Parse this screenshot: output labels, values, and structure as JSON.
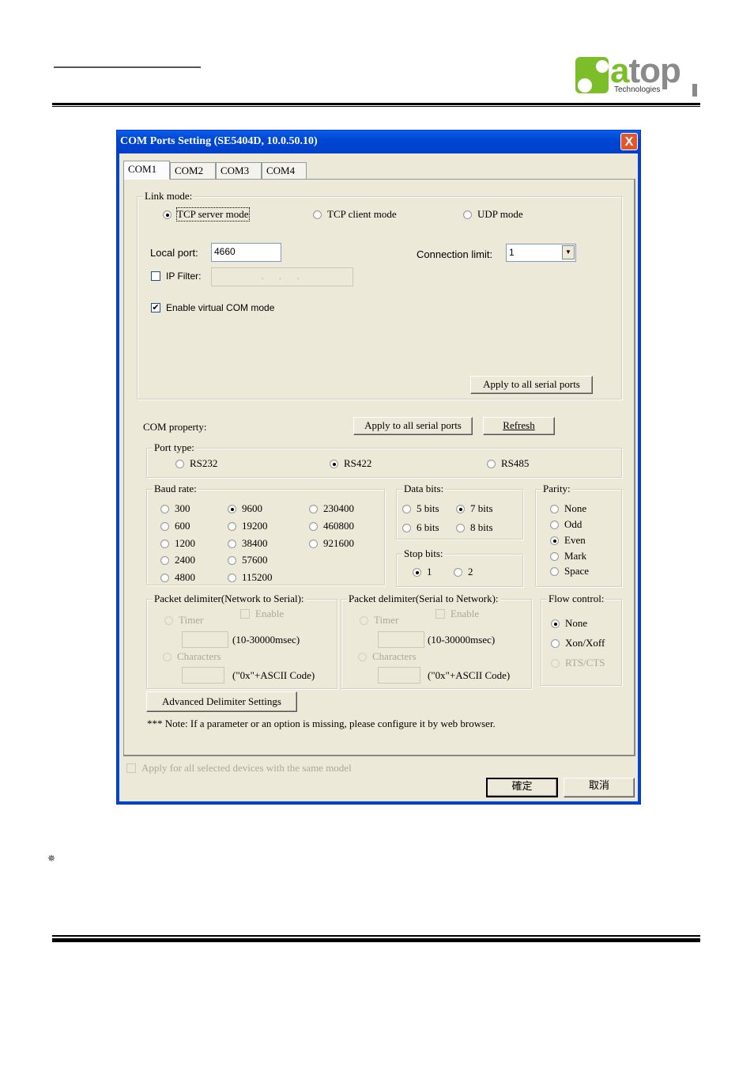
{
  "page": {
    "logo": {
      "brand": "atop",
      "subtitle": "Technologies",
      "green": "#7cbd2a",
      "gray": "#8a8a8a"
    },
    "bullet_icon": "✵"
  },
  "window": {
    "title": "COM Ports Setting (SE5404D, 10.0.50.10)",
    "close_label": "X",
    "tabs": [
      {
        "label": "COM1",
        "active": true
      },
      {
        "label": "COM2",
        "active": false
      },
      {
        "label": "COM3",
        "active": false
      },
      {
        "label": "COM4",
        "active": false
      }
    ],
    "link_mode": {
      "label": "Link mode:",
      "options": [
        "TCP server mode",
        "TCP client mode",
        "UDP mode"
      ],
      "selected": "TCP server mode",
      "local_port_label": "Local port:",
      "local_port_value": "4660",
      "connection_limit_label": "Connection limit:",
      "connection_limit_value": "1",
      "ip_filter_label": "IP Filter:",
      "ip_filter_checked": false,
      "ip_filter_value": ".   .   .",
      "virtual_com_label": "Enable virtual COM mode",
      "virtual_com_checked": true,
      "apply_button": "Apply to all serial ports"
    },
    "com_property": {
      "label": "COM property:",
      "apply_button": "Apply to all serial ports",
      "refresh_button": "Refresh"
    },
    "port_type": {
      "label": "Port type:",
      "options": [
        "RS232",
        "RS422",
        "RS485"
      ],
      "selected": "RS422"
    },
    "baud_rate": {
      "label": "Baud rate:",
      "options": [
        "300",
        "600",
        "1200",
        "2400",
        "4800",
        "9600",
        "19200",
        "38400",
        "57600",
        "115200",
        "230400",
        "460800",
        "921600"
      ],
      "selected": "9600"
    },
    "data_bits": {
      "label": "Data bits:",
      "options": [
        "5 bits",
        "7 bits",
        "6 bits",
        "8 bits"
      ],
      "selected": "7 bits"
    },
    "stop_bits": {
      "label": "Stop bits:",
      "options": [
        "1",
        "2"
      ],
      "selected": "1"
    },
    "parity": {
      "label": "Parity:",
      "options": [
        "None",
        "Odd",
        "Even",
        "Mark",
        "Space"
      ],
      "selected": "Even"
    },
    "delim_net_to_serial": {
      "label": "Packet delimiter(Network to Serial):",
      "enable_label": "Enable",
      "timer_label": "Timer",
      "timer_range": "(10-30000msec)",
      "characters_label": "Characters",
      "characters_hint": "(\"0x\"+ASCII Code)"
    },
    "delim_serial_to_net": {
      "label": "Packet delimiter(Serial to Network):",
      "enable_label": "Enable",
      "timer_label": "Timer",
      "timer_range": "(10-30000msec)",
      "characters_label": "Characters",
      "characters_hint": "(\"0x\"+ASCII Code)"
    },
    "flow_control": {
      "label": "Flow control:",
      "options": [
        "None",
        "Xon/Xoff",
        "RTS/CTS"
      ],
      "selected": "None"
    },
    "advanced_button": "Advanced Delimiter Settings",
    "note": "*** Note: If a parameter or an option is missing, please configure it by web browser.",
    "apply_all_devices_label": "Apply for all selected devices with the same model",
    "ok_button": "確定",
    "cancel_button": "取消"
  }
}
